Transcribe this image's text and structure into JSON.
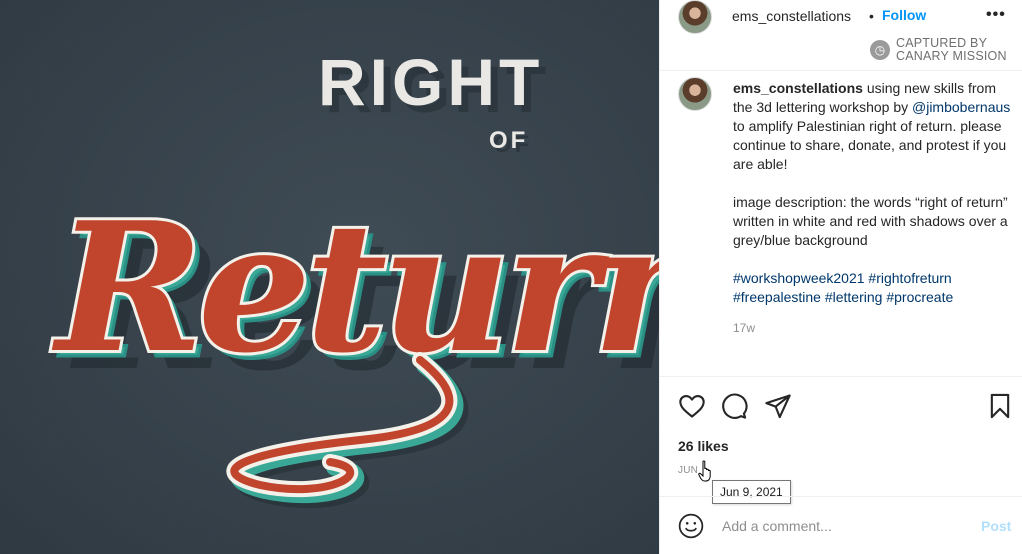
{
  "post": {
    "artwork_text": {
      "line1": "RIGHT",
      "line2": "OF",
      "line3": "Return"
    }
  },
  "header": {
    "username": "ems_constellations",
    "separator": "•",
    "follow_label": "Follow",
    "more_icon": "more-horizontal-icon",
    "more_label": "•••"
  },
  "watermark": {
    "line1": "CAPTURED BY",
    "line2": "CANARY MISSION",
    "icon": "clock-icon",
    "icon_glyph": "◷"
  },
  "caption": {
    "username": "ems_constellations",
    "text_before_mention": " using new skills from the 3d lettering workshop by ",
    "mention": "@jimbobernaus",
    "text_after_mention": " to amplify Palestinian right of return. please continue to share, donate, and protest if you are able!",
    "description": "image description: the words “right of return” written in white and red with shadows over a grey/blue background",
    "hashtags": [
      "#workshopweek2021",
      "#rightofreturn",
      "#freepalestine",
      "#lettering",
      "#procreate"
    ],
    "age": "17w"
  },
  "actions": {
    "like_icon": "heart-icon",
    "comment_icon": "comment-icon",
    "share_icon": "paper-plane-icon",
    "save_icon": "bookmark-icon"
  },
  "stats": {
    "likes": "26 likes",
    "date_short": "JUN",
    "tooltip": "Jun 9, 2021"
  },
  "comment": {
    "emoji_icon": "smiley-icon",
    "placeholder": "Add a comment...",
    "post_label": "Post"
  }
}
